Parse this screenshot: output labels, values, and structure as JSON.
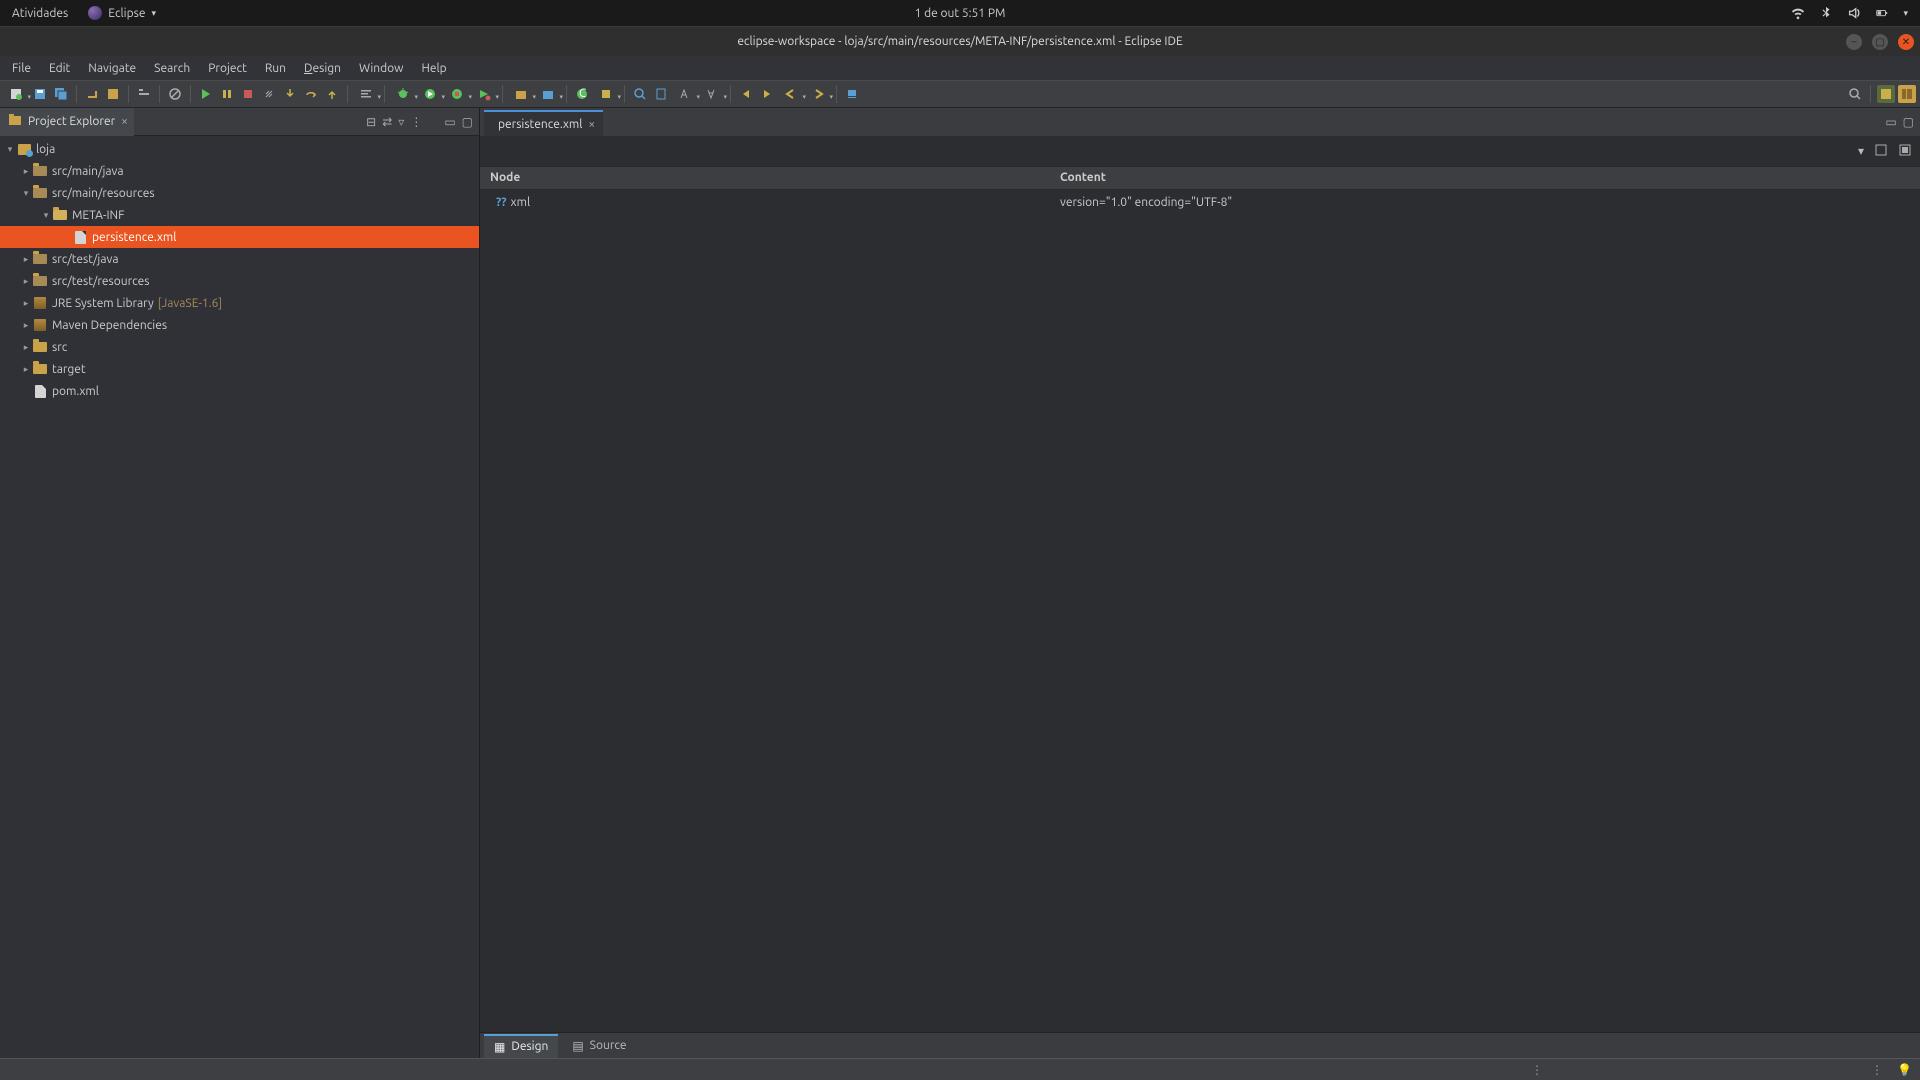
{
  "gnome": {
    "activities": "Atividades",
    "app": "Eclipse",
    "datetime": "1 de out  5:51 PM"
  },
  "window": {
    "title": "eclipse-workspace - loja/src/main/resources/META-INF/persistence.xml - Eclipse IDE"
  },
  "menubar": [
    "File",
    "Edit",
    "Navigate",
    "Search",
    "Project",
    "Run",
    "Design",
    "Window",
    "Help"
  ],
  "explorer": {
    "title": "Project Explorer",
    "project": "loja",
    "nodes": {
      "src_main_java": "src/main/java",
      "src_main_resources": "src/main/resources",
      "meta_inf": "META-INF",
      "persistence_xml": "persistence.xml",
      "src_test_java": "src/test/java",
      "src_test_resources": "src/test/resources",
      "jre_lib": "JRE System Library",
      "jre_note": "[JavaSE-1.6]",
      "maven_deps": "Maven Dependencies",
      "src": "src",
      "target": "target",
      "pom": "pom.xml"
    }
  },
  "editor": {
    "tab": "persistence.xml",
    "columns": {
      "node": "Node",
      "content": "Content"
    },
    "row": {
      "qmark": "?? ",
      "node": "xml",
      "content": "version=\"1.0\" encoding=\"UTF-8\""
    },
    "bottomTabs": {
      "design": "Design",
      "source": "Source"
    }
  }
}
